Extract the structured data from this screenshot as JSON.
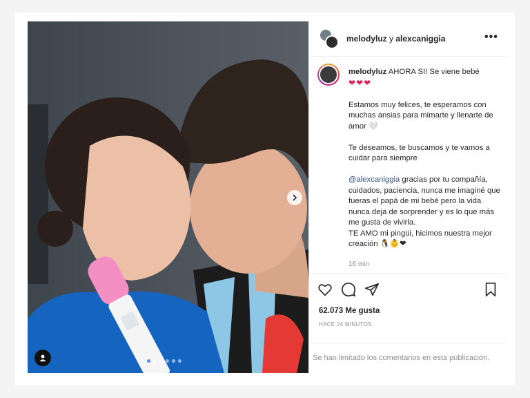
{
  "header": {
    "username1": "melodyluz",
    "conjunction": "y",
    "username2": "alexcaniggia",
    "more_label": "•••"
  },
  "caption": {
    "username": "melodyluz",
    "first_line": "AHORA SI! Se viene bebé",
    "hearts": "❤❤❤",
    "para2": "Estamos muy felices, te esperamos con muchas ansias para mimarte y llenarte de amor 🤍",
    "para3": "Te deseamos, te buscamos y te vamos a cuidar para siempre",
    "mention": "@alexcaniggia",
    "para4_rest": " gracias por tu compañía, cuidados, paciencia, nunca me imaginé que fueras el papá de mi bebé pero la vida nunca deja de sorprender y es lo que más me gusta de vivirla.",
    "para5": "TE AMO mi pingüi, hicimos nuestra mejor creación",
    "para5_emojis": "🐧👶❤",
    "time": "16 min"
  },
  "stats": {
    "likes": "62.073 Me gusta",
    "posted_ago": "HACE 24 MINUTOS"
  },
  "comments": {
    "limited_notice": "Se han limitado los comentarios en esta publicación."
  },
  "icons": {
    "like": "heart-icon",
    "comment": "comment-icon",
    "share": "send-icon",
    "save": "bookmark-icon",
    "next": "chevron-right-icon",
    "tagged": "user-icon"
  },
  "carousel": {
    "slides": 6,
    "active_index": 0
  },
  "colors": {
    "accent_mention": "#385185",
    "heart": "#e0245e",
    "carousel_active_dot": "#4a90e2"
  }
}
